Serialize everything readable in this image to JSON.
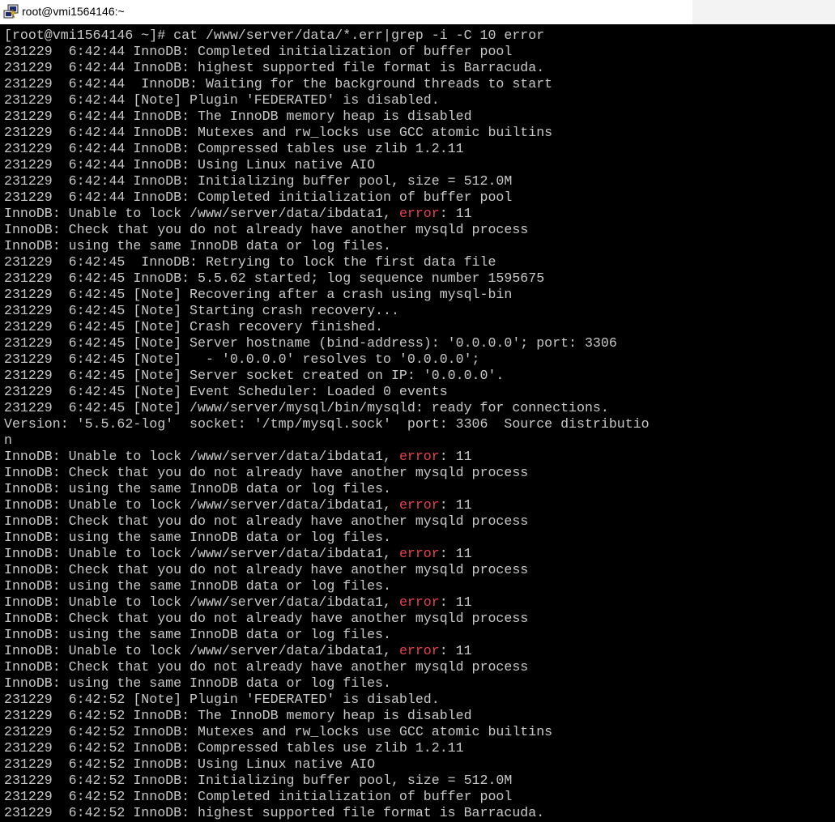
{
  "window": {
    "title": "root@vmi1564146:~",
    "icon": "putty-terminal-icon"
  },
  "colors": {
    "background": "#000000",
    "text": "#c8c8c8",
    "highlight_error": "#e8414a",
    "titlebar": "#ffffff"
  },
  "terminal": {
    "lines": [
      [
        {
          "t": "[root@vmi1564146 ~]# cat /www/server/data/*.err|grep -i -C 10 error"
        }
      ],
      [
        {
          "t": "231229  6:42:44 InnoDB: Completed initialization of buffer pool"
        }
      ],
      [
        {
          "t": "231229  6:42:44 InnoDB: highest supported file format is Barracuda."
        }
      ],
      [
        {
          "t": "231229  6:42:44  InnoDB: Waiting for the background threads to start"
        }
      ],
      [
        {
          "t": "231229  6:42:44 [Note] Plugin 'FEDERATED' is disabled."
        }
      ],
      [
        {
          "t": "231229  6:42:44 InnoDB: The InnoDB memory heap is disabled"
        }
      ],
      [
        {
          "t": "231229  6:42:44 InnoDB: Mutexes and rw_locks use GCC atomic builtins"
        }
      ],
      [
        {
          "t": "231229  6:42:44 InnoDB: Compressed tables use zlib 1.2.11"
        }
      ],
      [
        {
          "t": "231229  6:42:44 InnoDB: Using Linux native AIO"
        }
      ],
      [
        {
          "t": "231229  6:42:44 InnoDB: Initializing buffer pool, size = 512.0M"
        }
      ],
      [
        {
          "t": "231229  6:42:44 InnoDB: Completed initialization of buffer pool"
        }
      ],
      [
        {
          "t": "InnoDB: Unable to lock /www/server/data/ibdata1, "
        },
        {
          "t": "error",
          "hl": true
        },
        {
          "t": ": 11"
        }
      ],
      [
        {
          "t": "InnoDB: Check that you do not already have another mysqld process"
        }
      ],
      [
        {
          "t": "InnoDB: using the same InnoDB data or log files."
        }
      ],
      [
        {
          "t": "231229  6:42:45  InnoDB: Retrying to lock the first data file"
        }
      ],
      [
        {
          "t": "231229  6:42:45 InnoDB: 5.5.62 started; log sequence number 1595675"
        }
      ],
      [
        {
          "t": "231229  6:42:45 [Note] Recovering after a crash using mysql-bin"
        }
      ],
      [
        {
          "t": "231229  6:42:45 [Note] Starting crash recovery..."
        }
      ],
      [
        {
          "t": "231229  6:42:45 [Note] Crash recovery finished."
        }
      ],
      [
        {
          "t": "231229  6:42:45 [Note] Server hostname (bind-address): '0.0.0.0'; port: 3306"
        }
      ],
      [
        {
          "t": "231229  6:42:45 [Note]   - '0.0.0.0' resolves to '0.0.0.0';"
        }
      ],
      [
        {
          "t": "231229  6:42:45 [Note] Server socket created on IP: '0.0.0.0'."
        }
      ],
      [
        {
          "t": "231229  6:42:45 [Note] Event Scheduler: Loaded 0 events"
        }
      ],
      [
        {
          "t": "231229  6:42:45 [Note] /www/server/mysql/bin/mysqld: ready for connections."
        }
      ],
      [
        {
          "t": "Version: '5.5.62-log'  socket: '/tmp/mysql.sock'  port: 3306  Source distributio"
        }
      ],
      [
        {
          "t": "n"
        }
      ],
      [
        {
          "t": "InnoDB: Unable to lock /www/server/data/ibdata1, "
        },
        {
          "t": "error",
          "hl": true
        },
        {
          "t": ": 11"
        }
      ],
      [
        {
          "t": "InnoDB: Check that you do not already have another mysqld process"
        }
      ],
      [
        {
          "t": "InnoDB: using the same InnoDB data or log files."
        }
      ],
      [
        {
          "t": "InnoDB: Unable to lock /www/server/data/ibdata1, "
        },
        {
          "t": "error",
          "hl": true
        },
        {
          "t": ": 11"
        }
      ],
      [
        {
          "t": "InnoDB: Check that you do not already have another mysqld process"
        }
      ],
      [
        {
          "t": "InnoDB: using the same InnoDB data or log files."
        }
      ],
      [
        {
          "t": "InnoDB: Unable to lock /www/server/data/ibdata1, "
        },
        {
          "t": "error",
          "hl": true
        },
        {
          "t": ": 11"
        }
      ],
      [
        {
          "t": "InnoDB: Check that you do not already have another mysqld process"
        }
      ],
      [
        {
          "t": "InnoDB: using the same InnoDB data or log files."
        }
      ],
      [
        {
          "t": "InnoDB: Unable to lock /www/server/data/ibdata1, "
        },
        {
          "t": "error",
          "hl": true
        },
        {
          "t": ": 11"
        }
      ],
      [
        {
          "t": "InnoDB: Check that you do not already have another mysqld process"
        }
      ],
      [
        {
          "t": "InnoDB: using the same InnoDB data or log files."
        }
      ],
      [
        {
          "t": "InnoDB: Unable to lock /www/server/data/ibdata1, "
        },
        {
          "t": "error",
          "hl": true
        },
        {
          "t": ": 11"
        }
      ],
      [
        {
          "t": "InnoDB: Check that you do not already have another mysqld process"
        }
      ],
      [
        {
          "t": "InnoDB: using the same InnoDB data or log files."
        }
      ],
      [
        {
          "t": "231229  6:42:52 [Note] Plugin 'FEDERATED' is disabled."
        }
      ],
      [
        {
          "t": "231229  6:42:52 InnoDB: The InnoDB memory heap is disabled"
        }
      ],
      [
        {
          "t": "231229  6:42:52 InnoDB: Mutexes and rw_locks use GCC atomic builtins"
        }
      ],
      [
        {
          "t": "231229  6:42:52 InnoDB: Compressed tables use zlib 1.2.11"
        }
      ],
      [
        {
          "t": "231229  6:42:52 InnoDB: Using Linux native AIO"
        }
      ],
      [
        {
          "t": "231229  6:42:52 InnoDB: Initializing buffer pool, size = 512.0M"
        }
      ],
      [
        {
          "t": "231229  6:42:52 InnoDB: Completed initialization of buffer pool"
        }
      ],
      [
        {
          "t": "231229  6:42:52 InnoDB: highest supported file format is Barracuda."
        }
      ]
    ]
  }
}
